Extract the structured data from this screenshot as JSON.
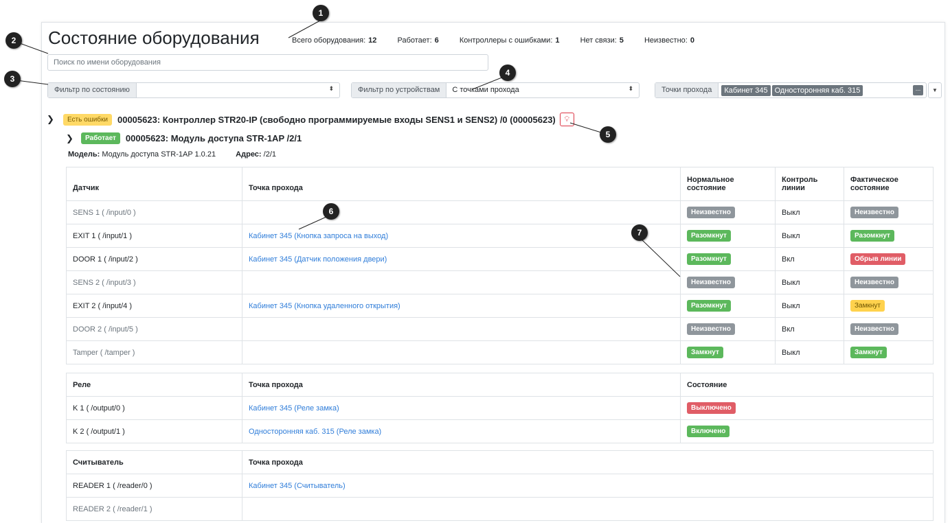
{
  "page": {
    "title": "Состояние оборудования",
    "stats": [
      {
        "label": "Всего оборудования:",
        "value": "12"
      },
      {
        "label": "Работает:",
        "value": "6"
      },
      {
        "label": "Контроллеры с ошибками:",
        "value": "1"
      },
      {
        "label": "Нет связи:",
        "value": "5"
      },
      {
        "label": "Неизвестно:",
        "value": "0"
      }
    ]
  },
  "search": {
    "placeholder": "Поиск по имени оборудования"
  },
  "filters": {
    "state_label": "Фильтр по состоянию",
    "state_value": "",
    "device_label": "Фильтр по устройствам",
    "device_value": "С точками прохода",
    "points_label": "Точки прохода",
    "points_tags": [
      "Кабинет 345",
      "Односторонняя каб. 315"
    ],
    "more_label": "..."
  },
  "controller": {
    "badge": "Есть ошибки",
    "title": "00005623: Контроллер STR20-IP (свободно программируемые входы SENS1 и SENS2) /0 (00005623)"
  },
  "module": {
    "badge": "Работает",
    "title": "00005623: Модуль доступа STR-1AP /2/1",
    "model_label": "Модель:",
    "model_value": "Модуль доступа STR-1AP 1.0.21",
    "address_label": "Адрес:",
    "address_value": "/2/1"
  },
  "sensors": {
    "headers": [
      "Датчик",
      "Точка прохода",
      "Нормальное состояние",
      "Контроль линии",
      "Фактическое состояние"
    ],
    "rows": [
      {
        "name": "SENS 1 ( /input/0 )",
        "point": "",
        "normal": "Неизвестно",
        "line": "Выкл",
        "actual": "Неизвестно",
        "dim": true
      },
      {
        "name": "EXIT 1 ( /input/1 )",
        "point": "Кабинет 345 (Кнопка запроса на выход)",
        "normal": "Разомкнут",
        "line": "Выкл",
        "actual": "Разомкнут",
        "dim": false
      },
      {
        "name": "DOOR 1 ( /input/2 )",
        "point": "Кабинет 345 (Датчик положения двери)",
        "normal": "Разомкнут",
        "line": "Вкл",
        "actual": "Обрыв линии",
        "dim": false
      },
      {
        "name": "SENS 2 ( /input/3 )",
        "point": "",
        "normal": "Неизвестно",
        "line": "Выкл",
        "actual": "Неизвестно",
        "dim": true
      },
      {
        "name": "EXIT 2 ( /input/4 )",
        "point": "Кабинет 345 (Кнопка удаленного открытия)",
        "normal": "Разомкнут",
        "line": "Выкл",
        "actual": "Замкнут",
        "dim": false
      },
      {
        "name": "DOOR 2 ( /input/5 )",
        "point": "",
        "normal": "Неизвестно",
        "line": "Вкл",
        "actual": "Неизвестно",
        "dim": true
      },
      {
        "name": "Tamper ( /tamper )",
        "point": "",
        "normal": "Замкнут",
        "line": "Выкл",
        "actual": "Замкнут",
        "dim": true
      }
    ]
  },
  "relays": {
    "headers": [
      "Реле",
      "Точка прохода",
      "Состояние"
    ],
    "rows": [
      {
        "name": "K 1 ( /output/0 )",
        "point": "Кабинет 345 (Реле замка)",
        "state": "Выключено"
      },
      {
        "name": "K 2 ( /output/1 )",
        "point": "Односторонняя каб. 315 (Реле замка)",
        "state": "Включено"
      }
    ]
  },
  "readers": {
    "headers": [
      "Считыватель",
      "Точка прохода"
    ],
    "rows": [
      {
        "name": "READER 1 ( /reader/0 )",
        "point": "Кабинет 345 (Считыватель)",
        "dim": false
      },
      {
        "name": "READER 2 ( /reader/1 )",
        "point": "",
        "dim": true
      }
    ]
  },
  "callouts": [
    "1",
    "2",
    "3",
    "4",
    "5",
    "6",
    "7"
  ],
  "colors": {
    "ok": "#5cb85c",
    "unknown": "#8f969c",
    "error": "#e05d66",
    "warn": "#ffd24d",
    "link": "#2f7dd9"
  }
}
